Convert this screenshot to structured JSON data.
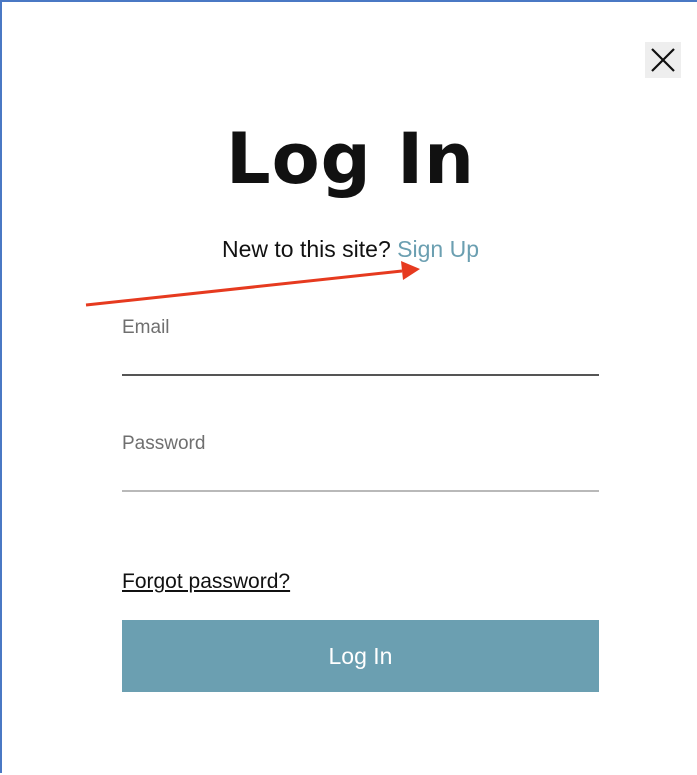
{
  "dialog": {
    "title": "Log In",
    "signup_prompt": "New to this site?",
    "signup_link": "Sign Up",
    "close_icon": "close-icon"
  },
  "form": {
    "email_label": "Email",
    "email_value": "",
    "password_label": "Password",
    "password_value": "",
    "forgot_password": "Forgot password?",
    "submit_label": "Log In"
  },
  "annotation": {
    "arrow_color": "#e63a1f"
  },
  "colors": {
    "accent": "#6b9fb1",
    "frame_border": "#4a78c4"
  }
}
